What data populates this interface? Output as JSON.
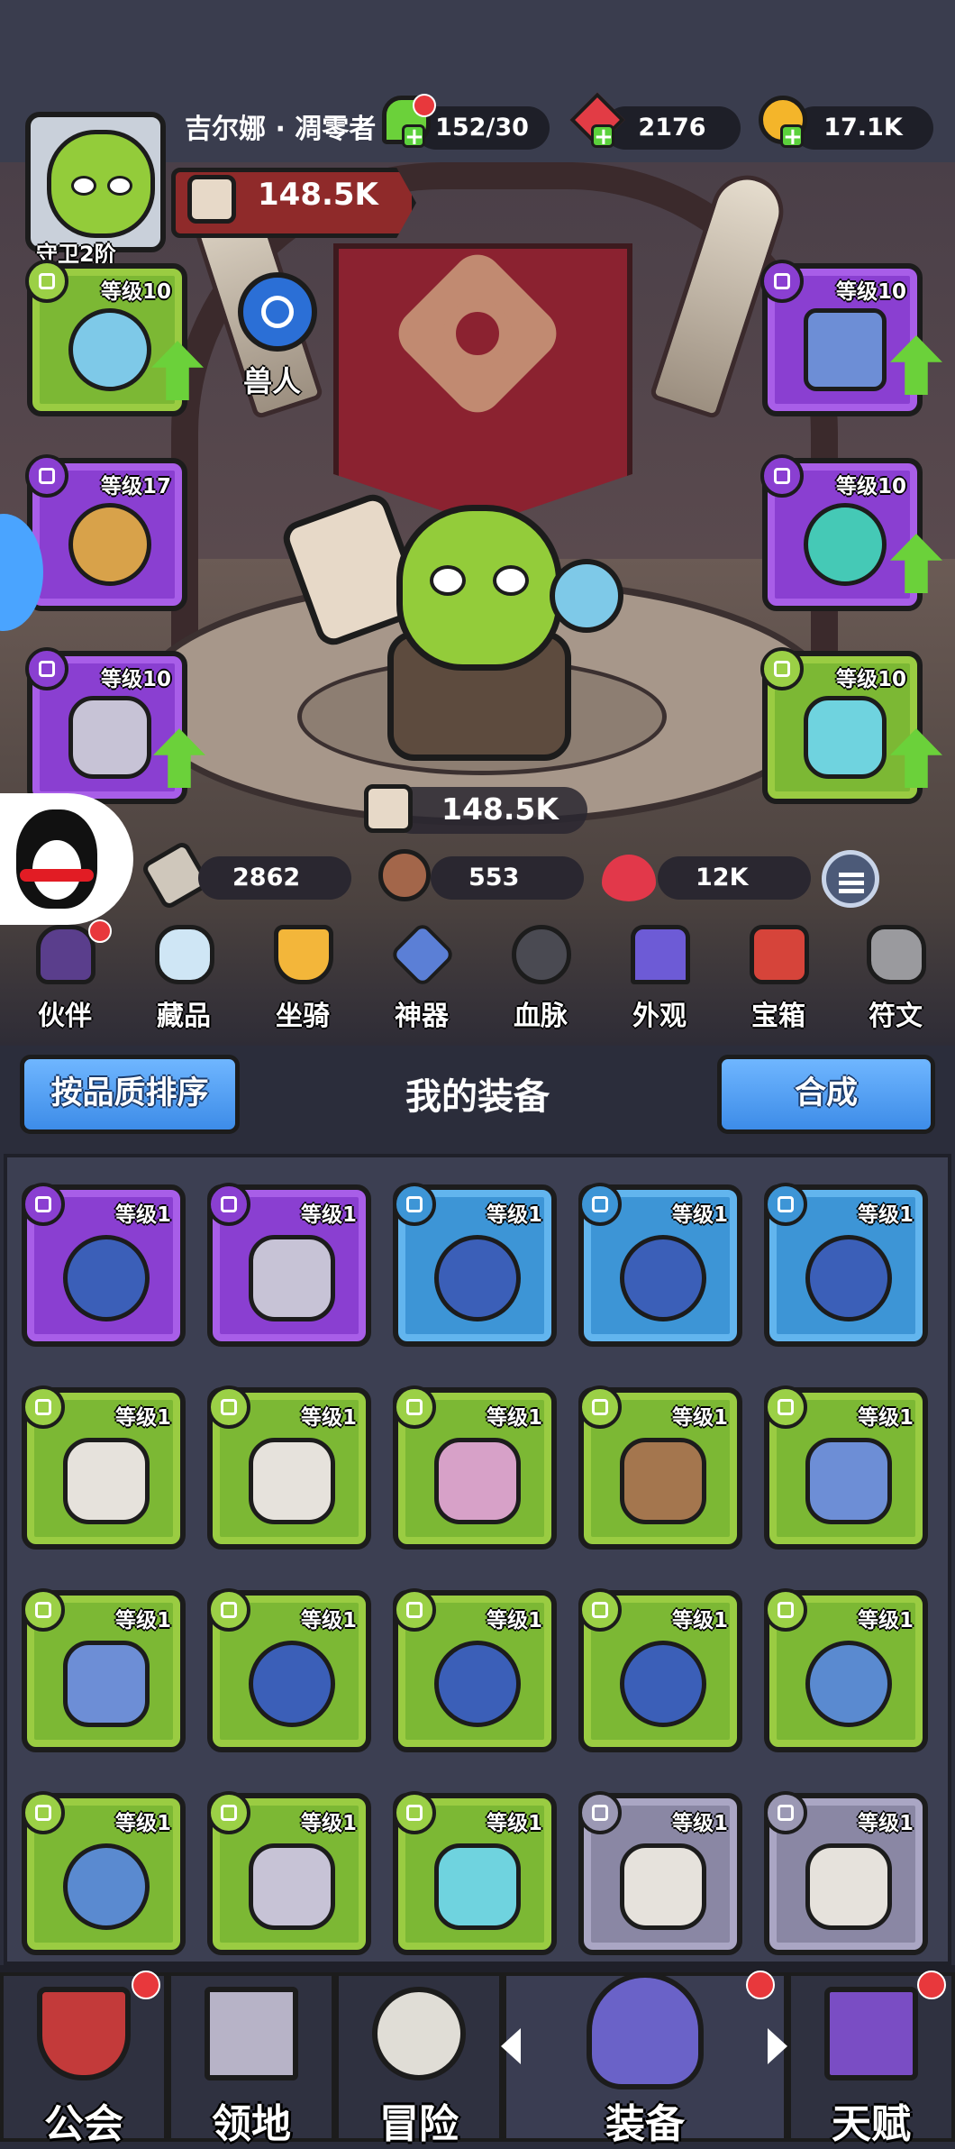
{
  "player": {
    "name": "吉尔娜 · 凋零者",
    "rank": "守卫2阶",
    "power": "148.5K",
    "race": "兽人"
  },
  "resources": {
    "stamina": "152/30",
    "gems": "2176",
    "gold": "17.1K"
  },
  "hero_stats": {
    "power": "148.5K",
    "attack": "2862",
    "defense": "553",
    "hp": "12K"
  },
  "equipped_slots": [
    {
      "level": "等级10",
      "rarity": "green",
      "icon": "staff-icon",
      "upgrade": true
    },
    {
      "level": "等级17",
      "rarity": "purple",
      "icon": "ring-icon",
      "upgrade": false
    },
    {
      "level": "等级10",
      "rarity": "purple",
      "icon": "amulet-icon",
      "upgrade": true
    },
    {
      "level": "等级10",
      "rarity": "purple",
      "icon": "armor-icon",
      "upgrade": true
    },
    {
      "level": "等级10",
      "rarity": "purple",
      "icon": "ring-icon",
      "upgrade": true
    },
    {
      "level": "等级10",
      "rarity": "green",
      "icon": "mask-amulet-icon",
      "upgrade": true
    }
  ],
  "categories": [
    {
      "label": "伙伴",
      "icon": "hooded-companion-icon",
      "badge": true
    },
    {
      "label": "藏品",
      "icon": "gem-collection-icon",
      "badge": false
    },
    {
      "label": "坐骑",
      "icon": "horseshoe-icon",
      "badge": false
    },
    {
      "label": "神器",
      "icon": "artifact-blade-icon",
      "badge": false
    },
    {
      "label": "血脉",
      "icon": "heart-crest-icon",
      "badge": false
    },
    {
      "label": "外观",
      "icon": "cape-icon",
      "badge": false
    },
    {
      "label": "宝箱",
      "icon": "treasure-chest-icon",
      "badge": false
    },
    {
      "label": "符文",
      "icon": "rune-stone-icon",
      "badge": false
    }
  ],
  "inventory": {
    "sort_label": "按品质排序",
    "title": "我的装备",
    "merge_label": "合成",
    "items": [
      {
        "level": "等级1",
        "rarity": "purple",
        "icon": "ring-icon"
      },
      {
        "level": "等级1",
        "rarity": "purple",
        "icon": "amulet-icon"
      },
      {
        "level": "等级1",
        "rarity": "blue",
        "icon": "ring-icon"
      },
      {
        "level": "等级1",
        "rarity": "blue",
        "icon": "ring-icon"
      },
      {
        "level": "等级1",
        "rarity": "blue",
        "icon": "ring-icon"
      },
      {
        "level": "等级1",
        "rarity": "green",
        "icon": "axe-icon"
      },
      {
        "level": "等级1",
        "rarity": "green",
        "icon": "axe-icon"
      },
      {
        "level": "等级1",
        "rarity": "green",
        "icon": "bow-icon"
      },
      {
        "level": "等级1",
        "rarity": "green",
        "icon": "leather-armor-icon"
      },
      {
        "level": "等级1",
        "rarity": "green",
        "icon": "armor-icon"
      },
      {
        "level": "等级1",
        "rarity": "green",
        "icon": "armor-icon"
      },
      {
        "level": "等级1",
        "rarity": "green",
        "icon": "ring-icon"
      },
      {
        "level": "等级1",
        "rarity": "green",
        "icon": "ring-icon"
      },
      {
        "level": "等级1",
        "rarity": "green",
        "icon": "ring-icon"
      },
      {
        "level": "等级1",
        "rarity": "green",
        "icon": "orb-amulet-icon"
      },
      {
        "level": "等级1",
        "rarity": "green",
        "icon": "orb-amulet-icon"
      },
      {
        "level": "等级1",
        "rarity": "green",
        "icon": "amulet-icon"
      },
      {
        "level": "等级1",
        "rarity": "green",
        "icon": "mask-amulet-icon"
      },
      {
        "level": "等级1",
        "rarity": "gray",
        "icon": "axe-icon"
      },
      {
        "level": "等级1",
        "rarity": "gray",
        "icon": "axe-icon"
      }
    ]
  },
  "bottom_nav": [
    {
      "label": "公会",
      "icon": "guild-banner-icon",
      "badge": true
    },
    {
      "label": "领地",
      "icon": "castle-icon",
      "badge": false
    },
    {
      "label": "冒险",
      "icon": "crossed-axes-icon",
      "badge": false
    },
    {
      "label": "装备",
      "icon": "horned-helmet-icon",
      "badge": true,
      "active": true
    },
    {
      "label": "天赋",
      "icon": "spellbook-icon",
      "badge": true
    }
  ],
  "colors": {
    "rarity_green": "#7cb834",
    "rarity_purple": "#8a3fd1",
    "rarity_blue": "#3d95d6",
    "rarity_gray": "#8a87a4",
    "button_blue": "#3d8ce8",
    "badge_red": "#e8383c"
  }
}
